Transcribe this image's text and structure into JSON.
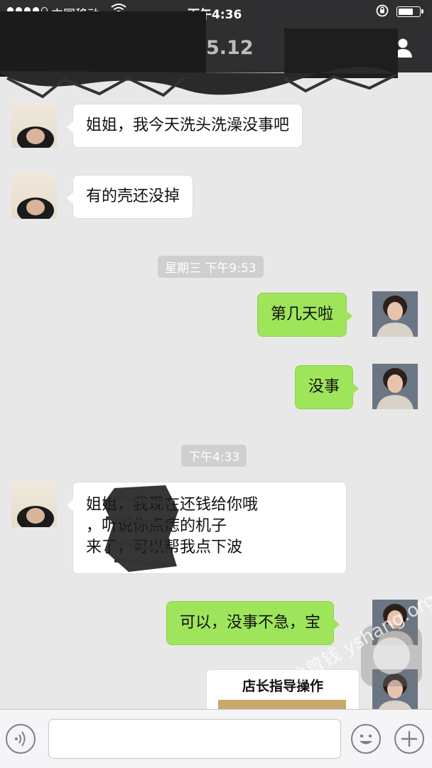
{
  "status_bar": {
    "carrier": "中国移动",
    "time": "下午4:36"
  },
  "nav": {
    "title_visible": "5.12"
  },
  "messages": [
    {
      "side": "left",
      "text": "姐姐，我今天洗头洗澡没事吧"
    },
    {
      "side": "left",
      "text": "有的壳还没掉"
    },
    {
      "side": "right",
      "text": "第几天啦"
    },
    {
      "side": "right",
      "text": "没事"
    },
    {
      "side": "left",
      "lines": [
        "姐姐，我现在还钱给你哦",
        "，听说你点痣的机子",
        "来了，可以帮我点下波"
      ]
    },
    {
      "side": "right",
      "text": "可以，没事不急，宝"
    }
  ],
  "timestamps": [
    "星期三 下午9:53",
    "下午4:33"
  ],
  "card": {
    "title": "店长指导操作"
  },
  "watermark": "徐曾钱 yshang.org",
  "icons": {
    "back": "chevron-left-icon",
    "contact": "person-icon",
    "voice": "voice-icon",
    "emoji": "smiley-icon",
    "plus": "plus-icon",
    "wifi": "wifi-icon",
    "lock": "rotation-lock-icon",
    "battery": "battery-icon"
  },
  "colors": {
    "bar": "#2f2f31",
    "chat_bg": "#e8e8e8",
    "my_bubble": "#9fe55b",
    "their_bubble": "#ffffff"
  }
}
